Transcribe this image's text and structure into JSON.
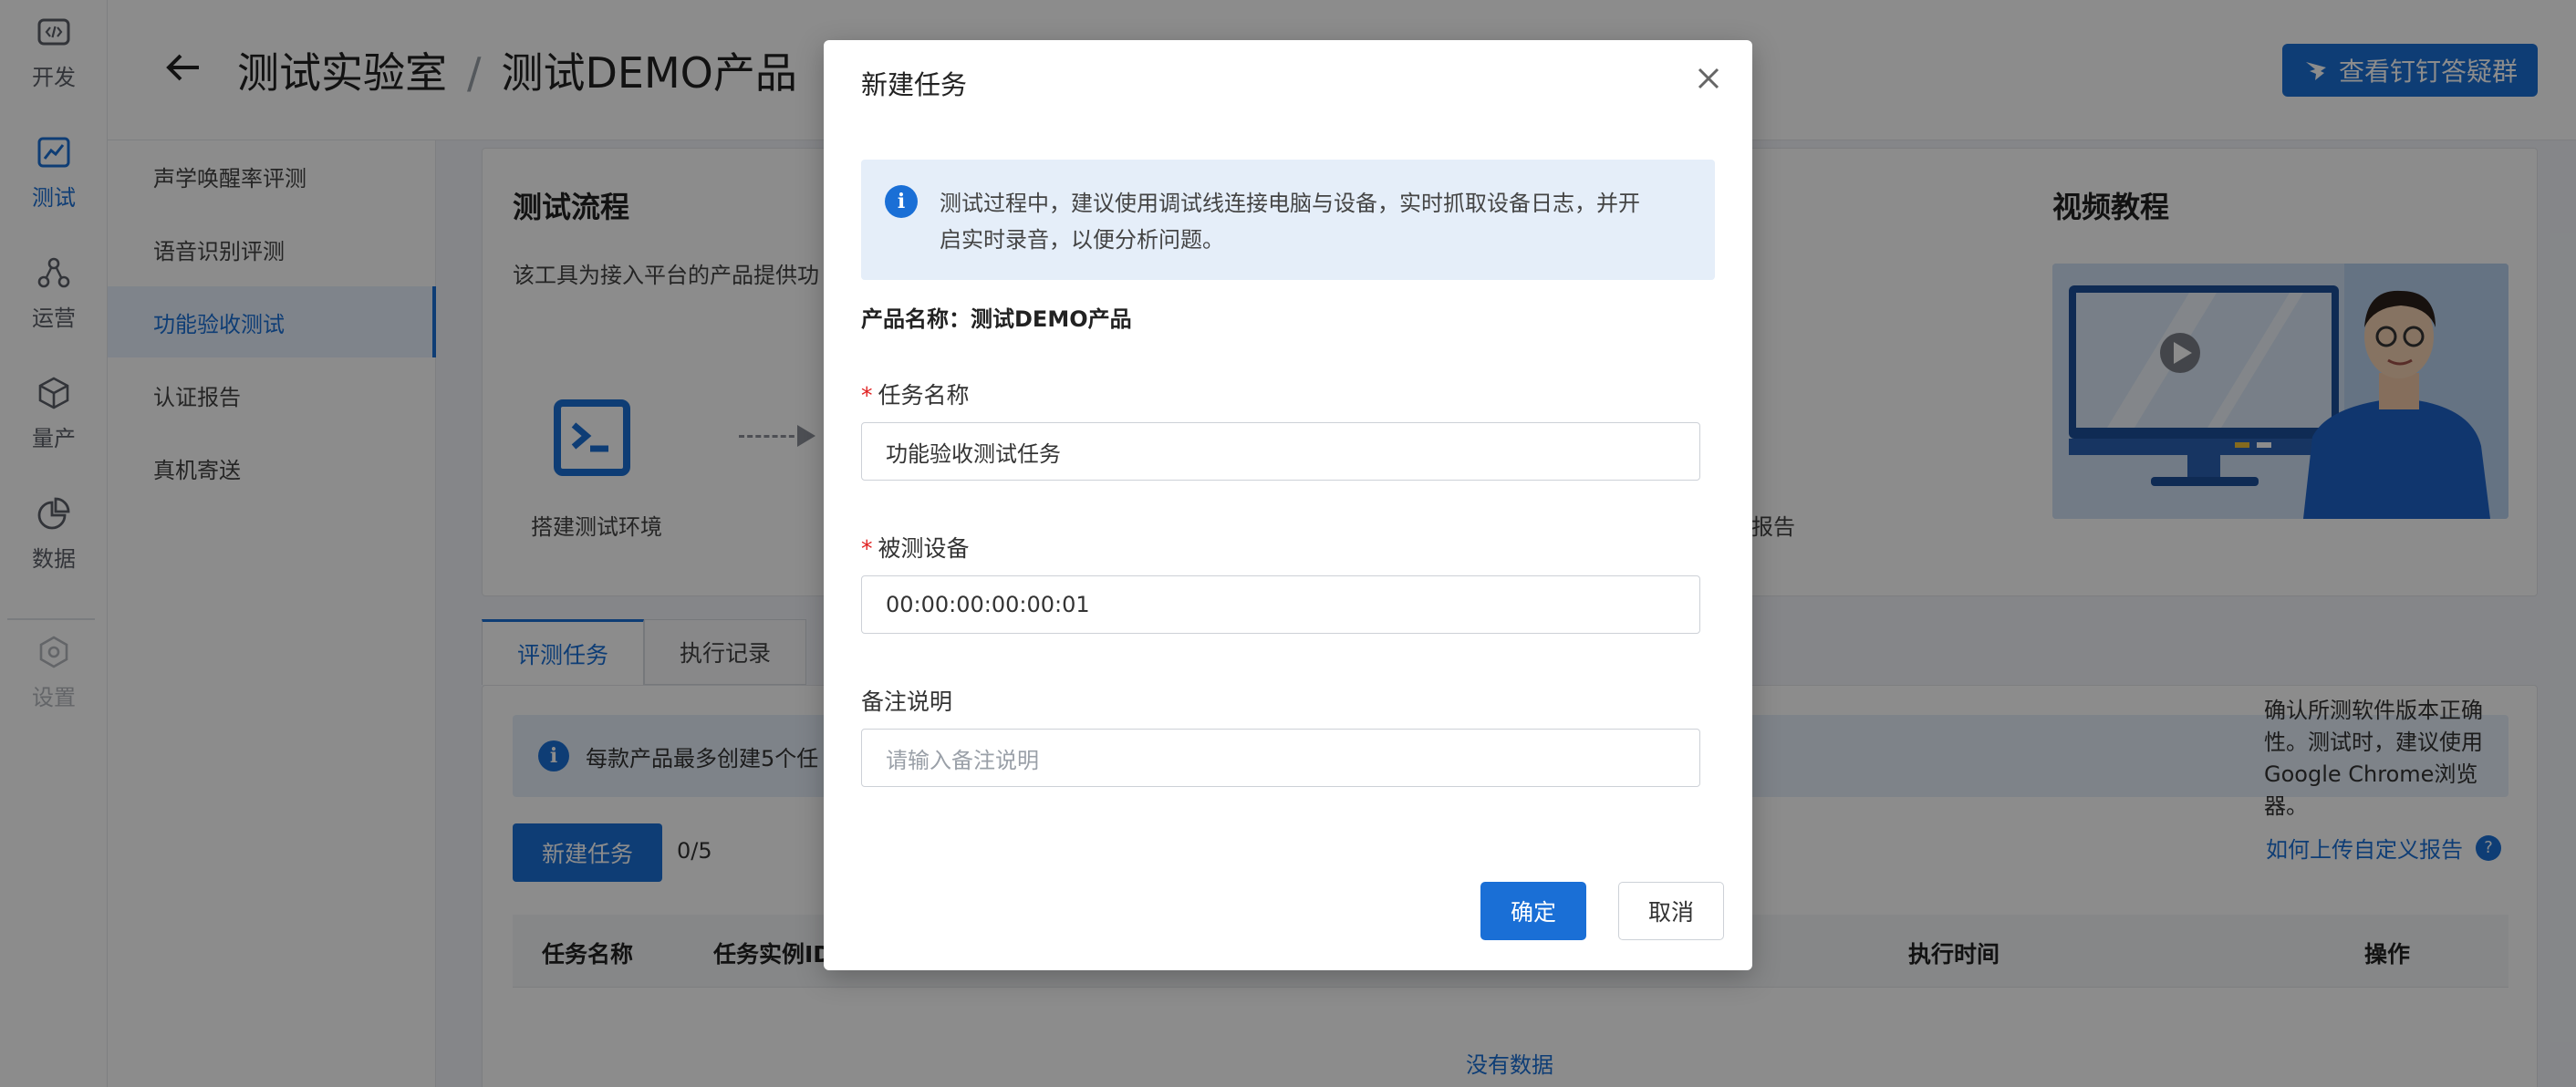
{
  "rail": {
    "items": [
      {
        "label": "开发",
        "icon": "code-icon"
      },
      {
        "label": "测试",
        "icon": "chart-line-icon"
      },
      {
        "label": "运营",
        "icon": "nodes-icon"
      },
      {
        "label": "量产",
        "icon": "box-icon"
      },
      {
        "label": "数据",
        "icon": "pie-chart-icon"
      },
      {
        "label": "设置",
        "icon": "settings-icon"
      }
    ],
    "active_index": 1
  },
  "header": {
    "breadcrumb_root": "测试实验室",
    "separator": "/",
    "breadcrumb_current": "测试DEMO产品",
    "dingtalk_button": "查看钉钉答疑群"
  },
  "subnav": {
    "items": [
      "声学唤醒率评测",
      "语音识别评测",
      "功能验收测试",
      "认证报告",
      "真机寄送"
    ],
    "active_index": 2
  },
  "flow": {
    "title": "测试流程",
    "desc": "该工具为接入平台的产品提供功",
    "step_env": "搭建测试环境",
    "step_report_partial": "报告"
  },
  "video": {
    "title": "视频教程"
  },
  "tabs": [
    "评测任务",
    "执行记录"
  ],
  "notice": {
    "left_text": "每款产品最多创建5个任",
    "right_text": "确认所测软件版本正确性。测试时，建议使用Google Chrome浏览器。"
  },
  "tasks": {
    "new_button": "新建任务",
    "count": "0/5",
    "help_link": "如何上传自定义报告",
    "help_q": "?"
  },
  "table": {
    "columns": {
      "name": "任务名称",
      "instance": "任务实例ID",
      "time": "执行时间",
      "ops": "操作"
    },
    "empty": "没有数据"
  },
  "modal": {
    "title": "新建任务",
    "alert": "测试过程中，建议使用调试线连接电脑与设备，实时抓取设备日志，并开启实时录音，以便分析问题。",
    "product_label": "产品名称：测试DEMO产品",
    "task_name_label": "任务名称",
    "task_name_value": "功能验收测试任务",
    "device_label": "被测设备",
    "device_value": "00:00:00:00:00:01",
    "remark_label": "备注说明",
    "remark_placeholder": "请输入备注说明",
    "required_mark": "*",
    "ok": "确定",
    "cancel": "取消"
  },
  "colors": {
    "accent": "#1a6fd6",
    "required": "#e02020",
    "overlay": "rgba(0,0,0,0.45)"
  }
}
